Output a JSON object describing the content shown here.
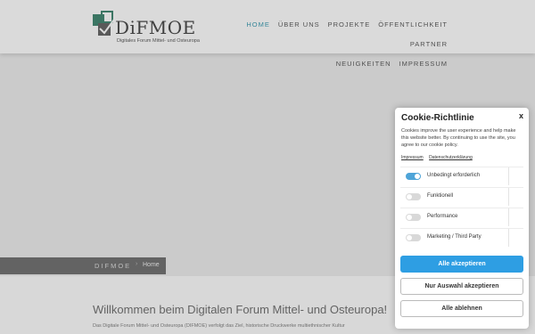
{
  "logo": {
    "name": "DiFMOE",
    "subtitle": "Digitales Forum Mittel- und Osteuropa"
  },
  "nav": {
    "items": [
      {
        "label": "HOME",
        "active": true
      },
      {
        "label": "ÜBER UNS",
        "active": false
      },
      {
        "label": "PROJEKTE",
        "active": false
      },
      {
        "label": "ÖFFENTLICHKEIT",
        "active": false
      },
      {
        "label": "PARTNER",
        "active": false
      },
      {
        "label": "NEUIGKEITEN",
        "active": false
      },
      {
        "label": "IMPRESSUM",
        "active": false
      }
    ],
    "active_color": "#3a8fa3"
  },
  "breadcrumb": {
    "site": "DIFMOE",
    "separator": "›",
    "page": "Home"
  },
  "content": {
    "heading": "Willkommen beim Digitalen Forum Mittel- und Osteuropa!",
    "intro": "Das Digitale Forum Mittel- und Osteuropa (DIFMOE) verfolgt das Ziel, historische Druckwerke multiethnischer Kultur"
  },
  "cookie": {
    "title": "Cookie-Richtlinie",
    "close": "x",
    "text": "Cookies improve the user experience and help make this website better. By continuing to use the site, you agree to our cookie policy.",
    "links": [
      "Impressum",
      "Datenschutzerklärung"
    ],
    "categories": [
      {
        "label": "Unbedingt erforderlich",
        "enabled": true
      },
      {
        "label": "Funktionell",
        "enabled": false
      },
      {
        "label": "Performance",
        "enabled": false
      },
      {
        "label": "Marketing / Third Party",
        "enabled": false
      }
    ],
    "buttons": {
      "accept_all": "Alle akzeptieren",
      "accept_selection": "Nur Auswahl akzeptieren",
      "reject_all": "Alle ablehnen"
    },
    "accent_color": "#2e9ee3"
  }
}
